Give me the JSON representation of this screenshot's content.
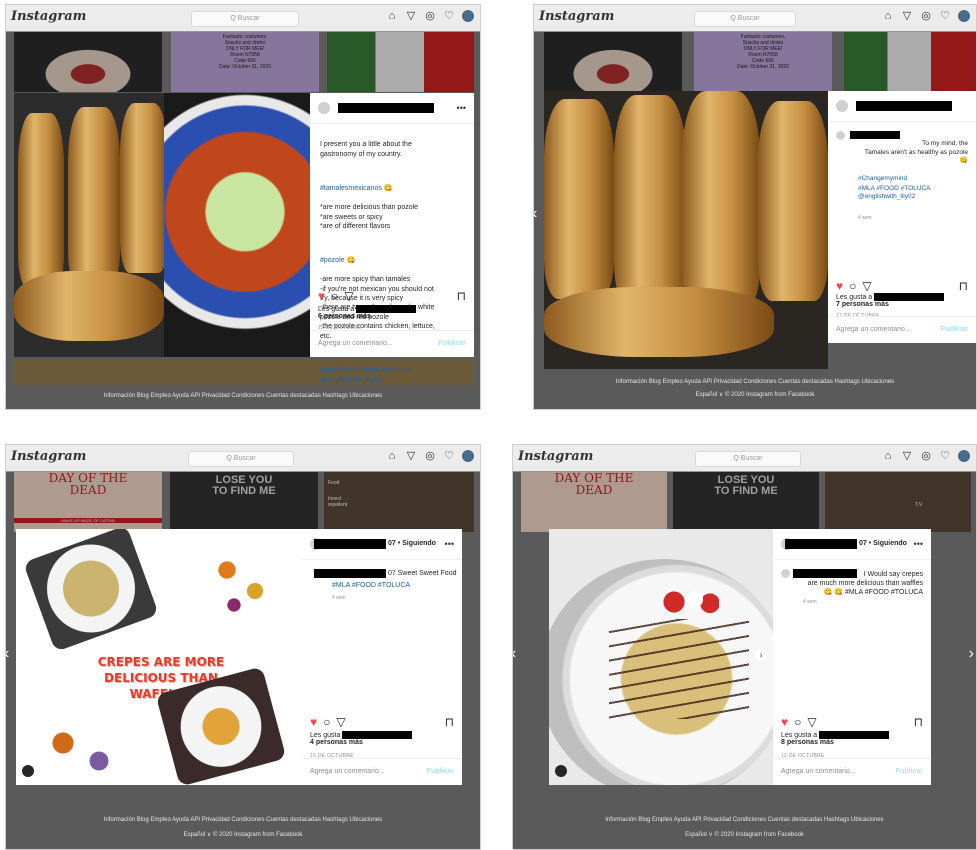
{
  "common": {
    "logo": "Instagram",
    "search_placeholder": "Q Buscar",
    "comment_placeholder": "Agrega un comentario...",
    "publish": "Publicar",
    "footer_links": "Información   Blog   Empleo   Ayuda   API   Privacidad   Condiciones   Cuentas destacadas   Hashtags   Ubicaciones",
    "footer_copy": "Español  ∨   © 2020 Instagram from Facebook",
    "icons": [
      "home-icon",
      "direct-icon",
      "explore-icon",
      "heart-icon",
      "avatar-icon"
    ]
  },
  "bg_texts": {
    "halloween_invite": "Fantastic costumes,\nSnacks and drinks\nONLY FOR MEE!\nRoom N7058\nCode 666\nDate: October 31, 2020",
    "dead_title": "DAY OF THE\nDEAD",
    "dead_sub": "MAKE-UP MADE OF CATRIN",
    "lose_you": "LOSE YOU\nTO FIND ME",
    "insect": "Insect\nrepellent",
    "tv": "T.V",
    "food": "Food"
  },
  "posts": [
    {
      "caption_intro": "I present you a little about the\ngastronomy of my country.",
      "caption_tag1": "#tamalesmexicanos 😋",
      "caption_body1": "*are more delicious than pozole\n*are sweets or spicy\n*are of different flavors",
      "caption_tag2": "#pozole 😋",
      "caption_body2": "-are more spicy than tamales\n-if you're not mexican you should not\ntry, because it is very spicy\n-there are two colors of pozole: white\npozole and red pozole\n-the pozole contains chicken, lettuce,\netc.",
      "caption_tags": "#mla #food #toluca #edomex\n@englishwith_lily02",
      "likes_prefix": "Les gusta a",
      "likes_count": "6 personas más",
      "date": "12 DE OCTUBRE"
    },
    {
      "caption": "To my mind, the\nTamales aren't as healthy as pozole😋",
      "caption_tag1": "#Changemymind",
      "caption_tags": "#MLA #FOOD #TOLUCA\n@englishwith_lily02",
      "time": "4 sem",
      "likes_prefix": "Les gusta a",
      "likes_count": "7 personas más",
      "date": "12 DE OCTUBRE"
    },
    {
      "header_suffix": "07 • Siguiendo",
      "caption": "07 Sweet Sweet Food",
      "caption_tags": "#MLA #FOOD #TOLUCA",
      "time": "4 sem",
      "image_text": "CREPES ARE MORE\nDELICIOUS THAN\nWAFFLES",
      "likes_prefix": "Les gusta",
      "likes_count": "4 personas más",
      "date": "15 DE OCTUBRE"
    },
    {
      "header_suffix": "07 • Siguiendo",
      "caption": "I Would say crepes\nare much more delicious than waffles\n😋 😋 #MLA #FOOD #TOLUCA",
      "time": "4 sem",
      "likes_prefix": "Les gusta a",
      "likes_count": "8 personas más",
      "date": "12 DE OCTUBRE"
    }
  ]
}
